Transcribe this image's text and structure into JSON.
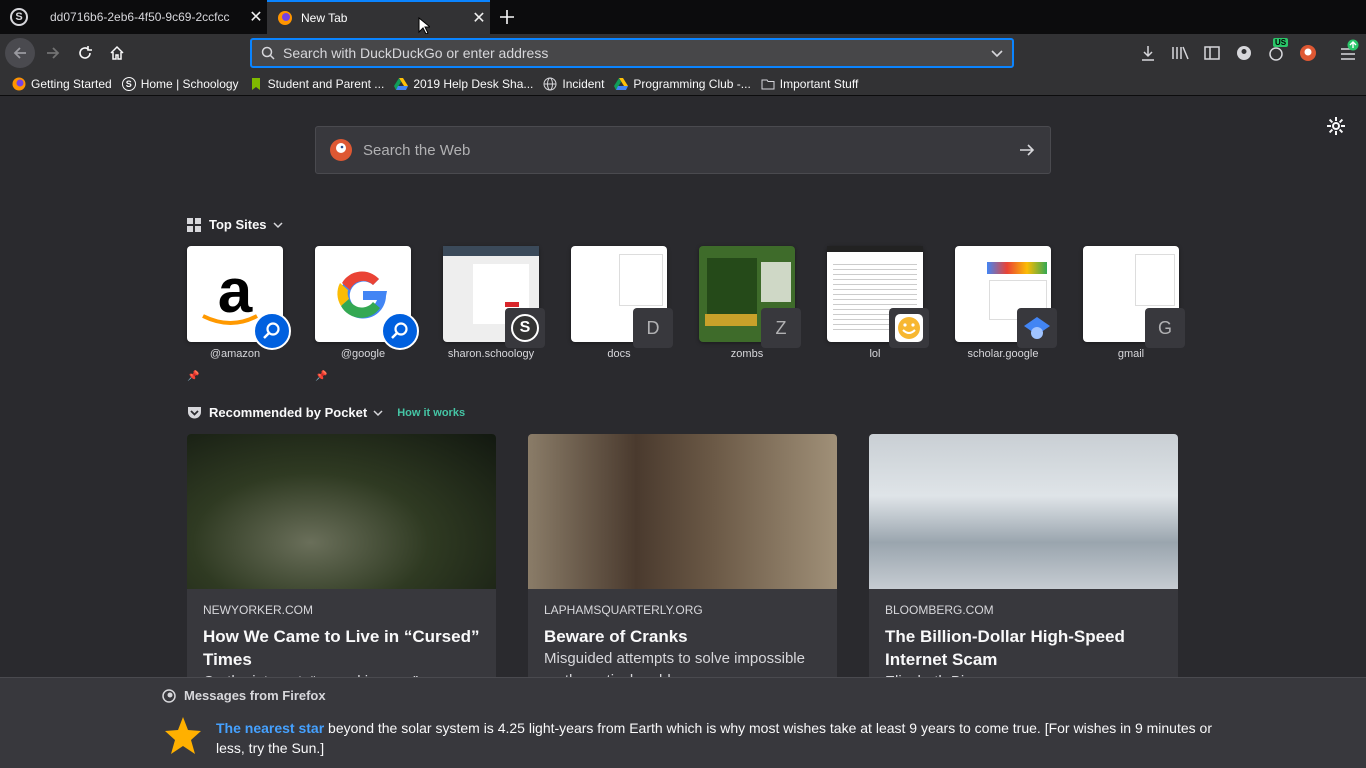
{
  "tabs": [
    {
      "title": "dd0716b6-2eb6-4f50-9c69-2ccfcc",
      "close": "✕"
    },
    {
      "title": "New Tab",
      "close": "✕"
    }
  ],
  "new_tab_icon": "plus-icon",
  "urlbar": {
    "placeholder": "Search with DuckDuckGo or enter address"
  },
  "toolbar_badge": "US",
  "bookmarks": [
    {
      "label": "Getting Started",
      "icon": "firefox-icon"
    },
    {
      "label": "Home | Schoology",
      "icon": "schoology-icon"
    },
    {
      "label": "Student and Parent ...",
      "icon": "bookmark-icon"
    },
    {
      "label": "2019 Help Desk Sha...",
      "icon": "google-drive-icon"
    },
    {
      "label": "Incident",
      "icon": "globe-icon"
    },
    {
      "label": "Programming Club -...",
      "icon": "google-drive-icon"
    },
    {
      "label": "Important Stuff",
      "icon": "folder-icon"
    }
  ],
  "websearch": {
    "placeholder": "Search the Web"
  },
  "topsites": {
    "title": "Top Sites",
    "sites": [
      {
        "label": "@amazon",
        "badge": ""
      },
      {
        "label": "@google",
        "badge": ""
      },
      {
        "label": "sharon.schoology",
        "badge": "S"
      },
      {
        "label": "docs",
        "badge": "D"
      },
      {
        "label": "zombs",
        "badge": "Z"
      },
      {
        "label": "lol",
        "badge": ""
      },
      {
        "label": "scholar.google",
        "badge": ""
      },
      {
        "label": "gmail",
        "badge": "G"
      }
    ]
  },
  "pocket": {
    "title": "Recommended by Pocket",
    "how": "How it works",
    "cards": [
      {
        "source": "NEWYORKER.COM",
        "title": "How We Came to Live in “Cursed” Times",
        "desc": "On the internet, “cursed images”..."
      },
      {
        "source": "LAPHAMSQUARTERLY.ORG",
        "title": "Beware of Cranks",
        "desc": "Misguided attempts to solve impossible mathematical problems."
      },
      {
        "source": "BLOOMBERG.COM",
        "title": "The Billion-Dollar High-Speed Internet Scam",
        "desc": "Elizabeth Bien..."
      }
    ]
  },
  "messages": {
    "header": "Messages from Firefox",
    "link": "The nearest star",
    "text": " beyond the solar system is 4.25 light-years from Earth which is why most wishes take at least 9 years to come true. [For wishes in 9 minutes or less, try the Sun.]"
  },
  "colors": {
    "accent": "#0a84ff",
    "link": "#45a1ff"
  }
}
